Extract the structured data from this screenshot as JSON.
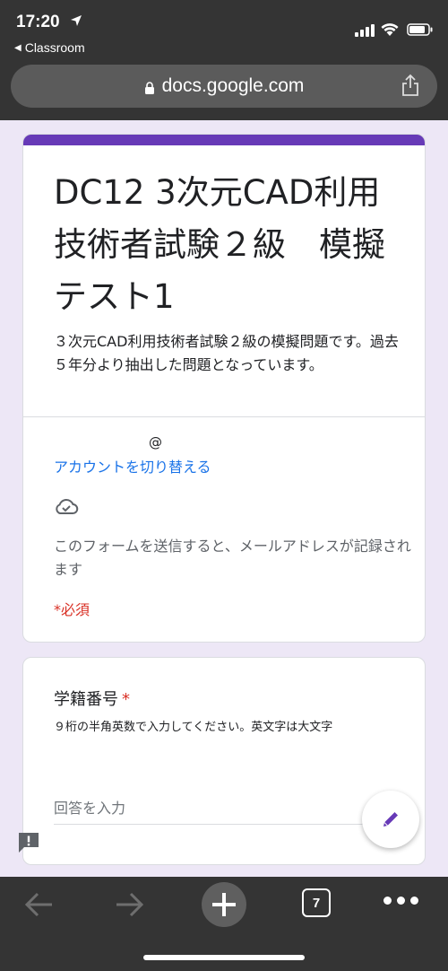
{
  "status_bar": {
    "time": "17:20",
    "back_app_label": "Classroom"
  },
  "browser": {
    "url": "docs.google.com",
    "tab_count": "7"
  },
  "form": {
    "accent_color": "#673ab7",
    "title": "DC12 3次元CAD利用技術者試験２級　模擬テスト1",
    "description": "３次元CAD利用技術者試験２級の模擬問題です。過去５年分より抽出した問題となっています。",
    "account_email": "@",
    "switch_account_link": "アカウントを切り替える",
    "email_notice": "このフォームを送信すると、メールアドレスが記録されます",
    "required_note": "*必須"
  },
  "question": {
    "title": "学籍番号",
    "required_mark": "*",
    "help_text": "９桁の半角英数で入力してください。英文字は大文字",
    "placeholder": "回答を入力",
    "value": ""
  }
}
